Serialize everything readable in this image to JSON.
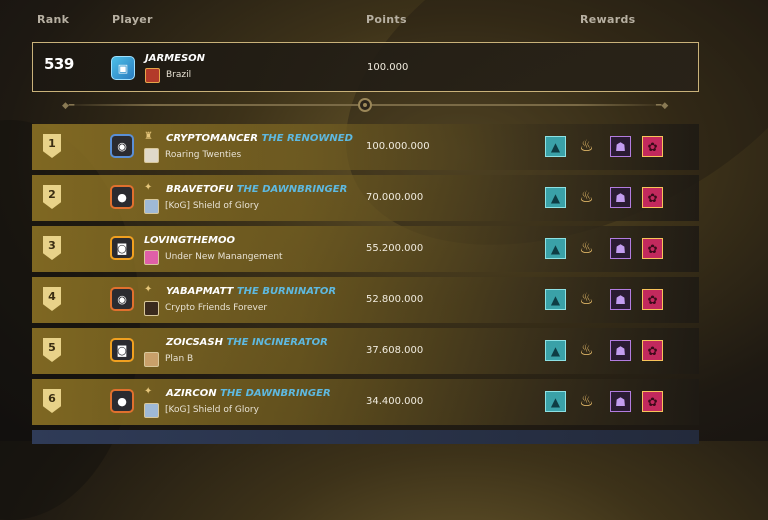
{
  "columns": {
    "rank": "Rank",
    "player": "Player",
    "points": "Points",
    "rewards": "Rewards"
  },
  "current_player": {
    "rank": "539",
    "name": "JARMESON",
    "guild": "Brazil",
    "points": "100.000",
    "avatar_icon": "cube-avatar-icon"
  },
  "rows": [
    {
      "rank": "1",
      "name": "CRYPTOMANCER",
      "title": "THE RENOWNED",
      "guild": "Roaring Twenties",
      "points": "100.000.000",
      "frame_color": "#5a8fd6"
    },
    {
      "rank": "2",
      "name": "BRAVETOFU",
      "title": "THE DAWNBRINGER",
      "guild": "[KoG] Shield of Glory",
      "points": "70.000.000",
      "frame_color": "#e0702e"
    },
    {
      "rank": "3",
      "name": "LOVINGTHEMOO",
      "title": "",
      "guild": "Under New Manangement",
      "points": "55.200.000",
      "frame_color": "#f0a020"
    },
    {
      "rank": "4",
      "name": "YABAPMATT",
      "title": "THE BURNINATOR",
      "guild": "Crypto Friends Forever",
      "points": "52.800.000",
      "frame_color": "#e0702e"
    },
    {
      "rank": "5",
      "name": "ZOICSASH",
      "title": "THE INCINERATOR",
      "guild": "Plan B",
      "points": "37.608.000",
      "frame_color": "#f0a020"
    },
    {
      "rank": "6",
      "name": "AZIRCON",
      "title": "THE DAWNBRINGER",
      "guild": "[KoG] Shield of Glory",
      "points": "34.400.000",
      "frame_color": "#e0702e"
    }
  ],
  "reward_icons": [
    "chevron-crest-icon",
    "flame-horn-icon",
    "purple-mask-icon",
    "pink-creature-icon"
  ],
  "colors": {
    "title_accent": "#5eb9e0",
    "row_gold": "#967a26",
    "rank_badge": "#e8d289"
  }
}
